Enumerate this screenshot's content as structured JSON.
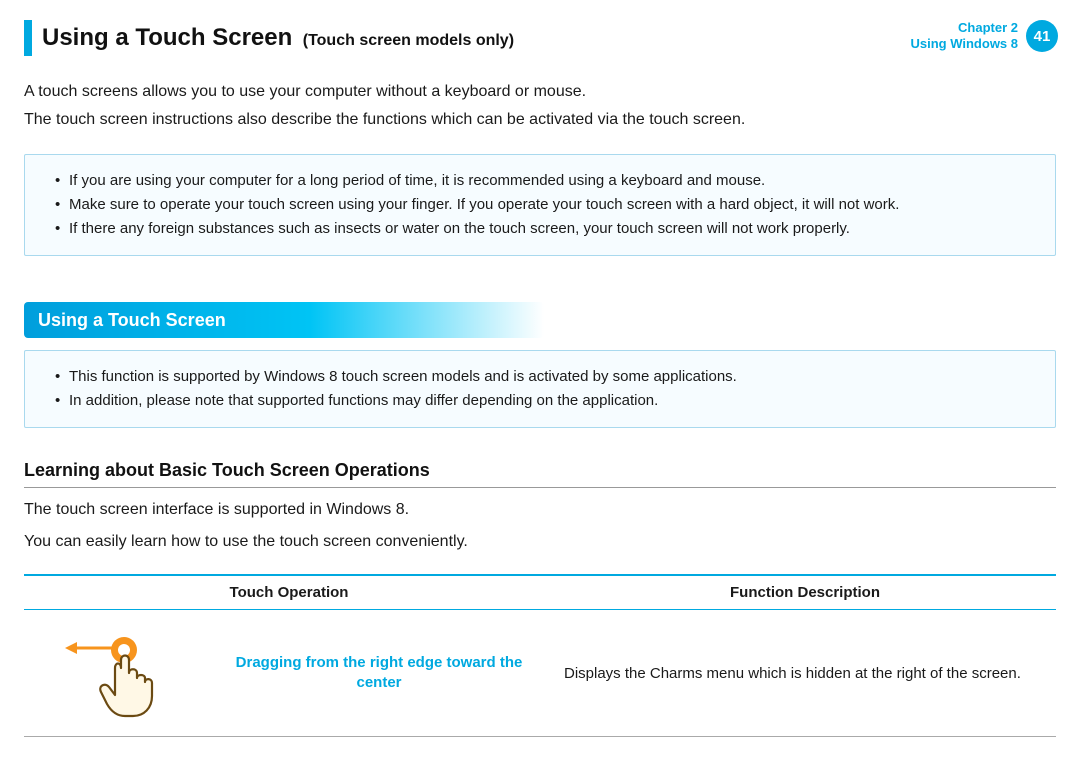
{
  "header": {
    "title": "Using a Touch Screen",
    "subtitle": "(Touch screen models only)",
    "chapter_line1": "Chapter 2",
    "chapter_line2": "Using Windows 8",
    "page_number": "41"
  },
  "intro": {
    "p1": "A touch screens allows you to use your computer without a keyboard or mouse.",
    "p2": "The touch screen instructions also describe the functions which can be activated via the touch screen."
  },
  "notes_top": [
    "If you are using your computer for a long period of time, it is recommended using a keyboard and mouse.",
    "Make sure to operate your touch screen using your finger. If you operate your touch screen with a hard object, it will not work.",
    "If there any foreign substances such as insects or water on the touch screen, your touch screen will not work properly."
  ],
  "section_heading": "Using a Touch Screen",
  "notes_mid": [
    "This function is supported by Windows 8 touch screen models and is activated by some applications.",
    "In addition, please note that supported functions may differ depending on the application."
  ],
  "subheading": "Learning about Basic Touch Screen Operations",
  "sub_intro": {
    "p1": "The touch screen interface is supported in Windows 8.",
    "p2": "You can easily learn how to use the touch screen conveniently."
  },
  "table": {
    "col1": "Touch Operation",
    "col2": "Function Description",
    "rows": [
      {
        "icon": "gesture-drag-left-icon",
        "operation": "Dragging from the right edge toward the center",
        "description": "Displays the Charms menu which is hidden at the right of the screen."
      }
    ]
  }
}
